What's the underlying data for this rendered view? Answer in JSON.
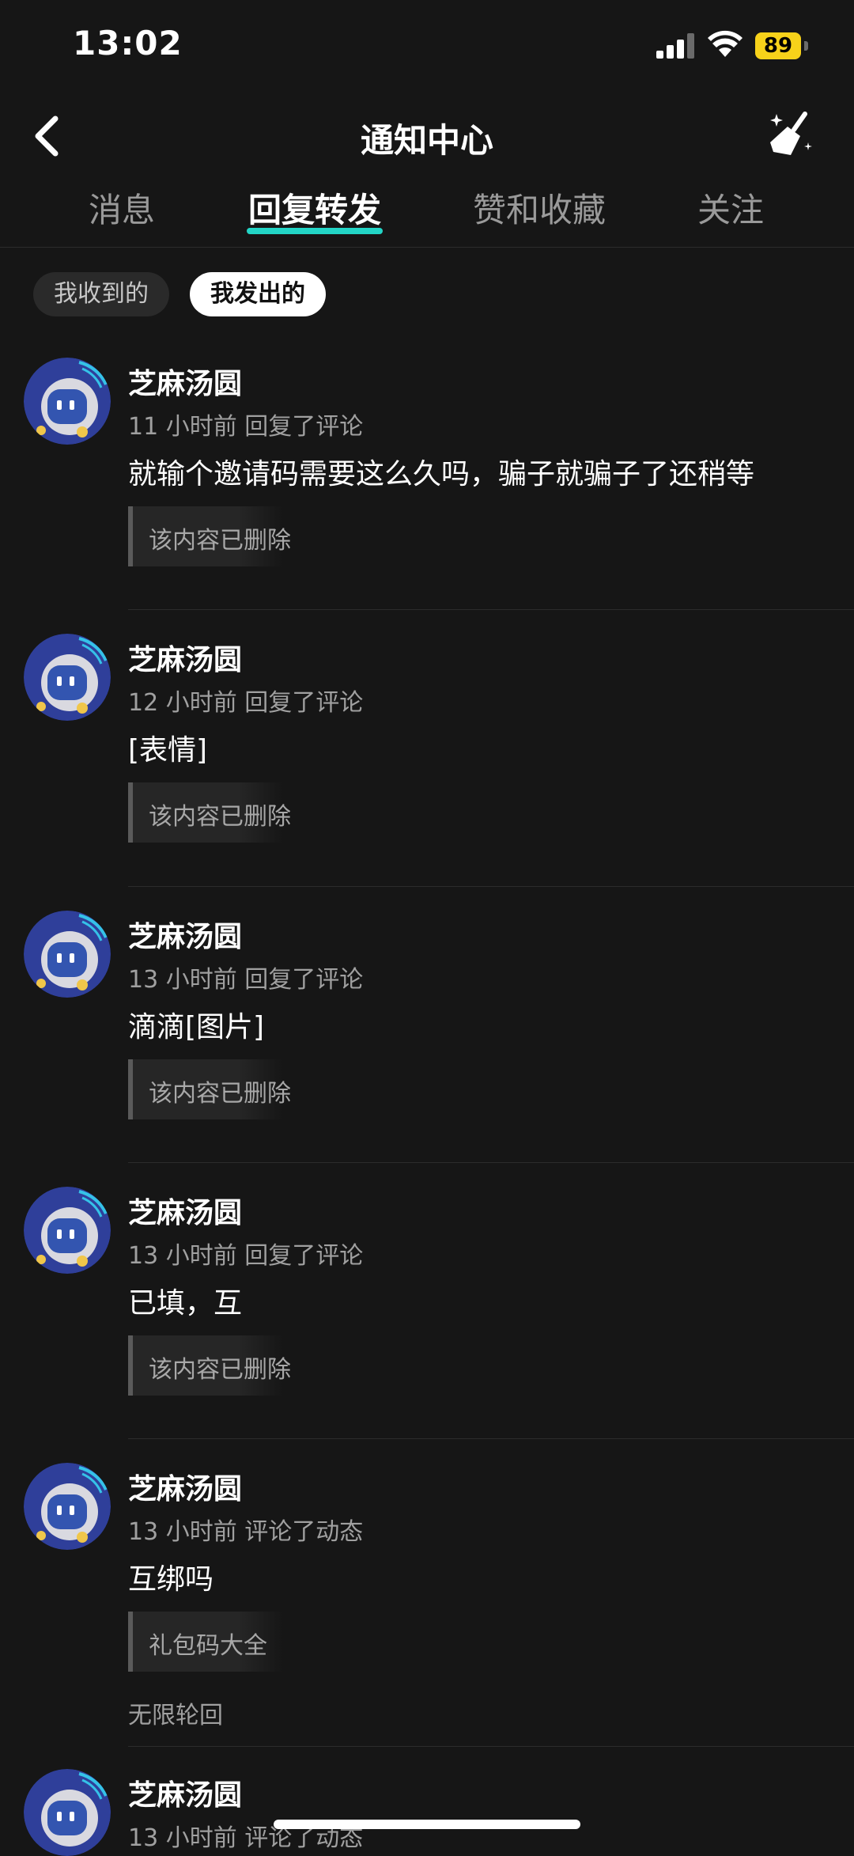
{
  "status": {
    "time": "13:02",
    "battery": "89"
  },
  "header": {
    "title": "通知中心"
  },
  "tabs": [
    {
      "label": "消息"
    },
    {
      "label": "回复转发"
    },
    {
      "label": "赞和收藏"
    },
    {
      "label": "关注"
    }
  ],
  "segments": {
    "received": "我收到的",
    "sent": "我发出的"
  },
  "items": [
    {
      "name": "芝麻汤圆",
      "meta": "11 小时前 回复了评论",
      "content": "就输个邀请码需要这么久吗，骗子就骗子了还稍等",
      "quote": "该内容已删除",
      "note": ""
    },
    {
      "name": "芝麻汤圆",
      "meta": "12 小时前 回复了评论",
      "content": "[表情]",
      "quote": "该内容已删除",
      "note": ""
    },
    {
      "name": "芝麻汤圆",
      "meta": "13 小时前 回复了评论",
      "content": "滴滴[图片]",
      "quote": "该内容已删除",
      "note": ""
    },
    {
      "name": "芝麻汤圆",
      "meta": "13 小时前 回复了评论",
      "content": "已填，互",
      "quote": "该内容已删除",
      "note": ""
    },
    {
      "name": "芝麻汤圆",
      "meta": "13 小时前 评论了动态",
      "content": "互绑吗",
      "quote": "礼包码大全",
      "note": "无限轮回"
    },
    {
      "name": "芝麻汤圆",
      "meta": "13 小时前 评论了动态",
      "content": "",
      "quote": "",
      "note": ""
    }
  ],
  "colors": {
    "accent": "#23d5c6",
    "background": "#161616",
    "battery": "#f7d21a"
  }
}
